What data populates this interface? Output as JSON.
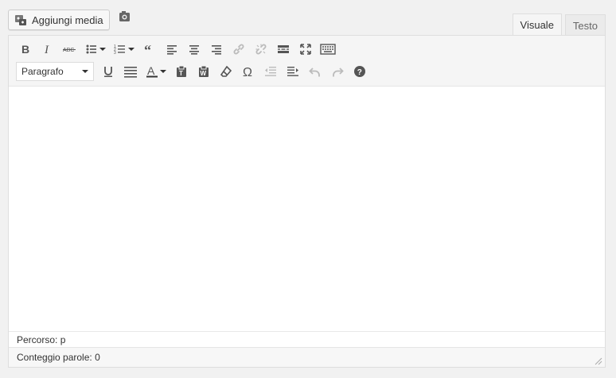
{
  "media": {
    "add_media_label": "Aggiungi media"
  },
  "tabs": [
    {
      "label": "Visuale",
      "active": true
    },
    {
      "label": "Testo",
      "active": false
    }
  ],
  "toolbar": {
    "format_select": "Paragrafo"
  },
  "status": {
    "path_label": "Percorso:",
    "path_value": "p",
    "word_count_label": "Conteggio parole:",
    "word_count_value": "0"
  },
  "colors": {
    "icon": "#555555",
    "icon_disabled": "#bbbbbb",
    "background": "#f1f1f1",
    "toolbar": "#f5f5f5"
  }
}
